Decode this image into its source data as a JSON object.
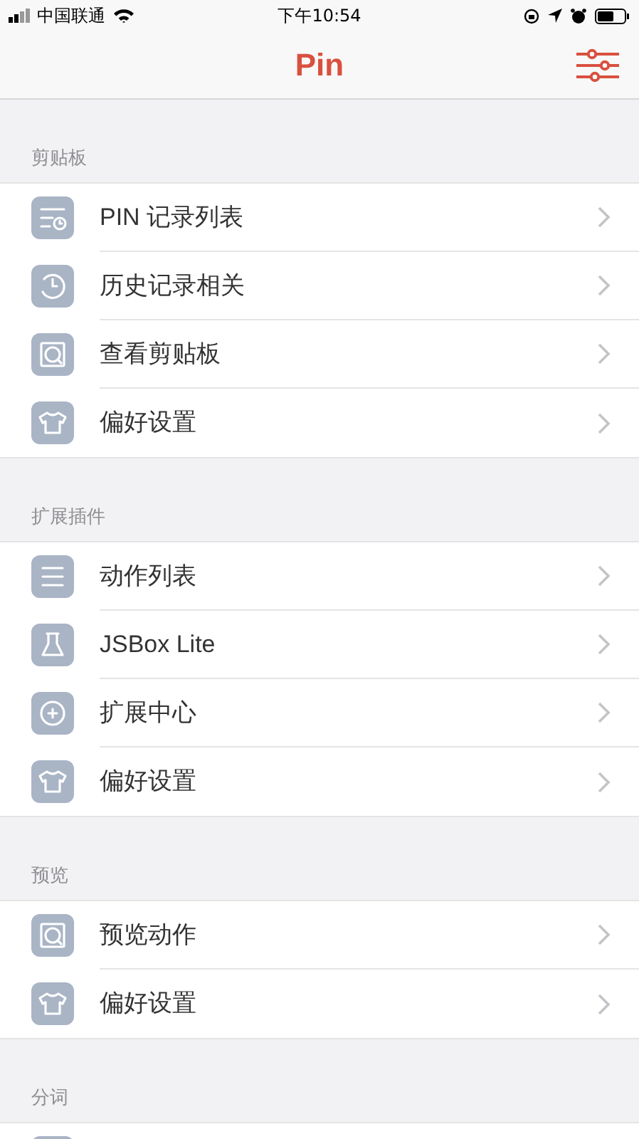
{
  "status_bar": {
    "carrier": "中国联通",
    "time": "下午10:54"
  },
  "nav": {
    "title": "Pin"
  },
  "sections": [
    {
      "title": "剪贴板",
      "rows": [
        {
          "kind": "list-clock",
          "label": "PIN 记录列表"
        },
        {
          "kind": "history",
          "label": "历史记录相关"
        },
        {
          "kind": "clipboard",
          "label": "查看剪贴板"
        },
        {
          "kind": "shirt",
          "label": "偏好设置"
        }
      ]
    },
    {
      "title": "扩展插件",
      "rows": [
        {
          "kind": "list",
          "label": "动作列表"
        },
        {
          "kind": "flask",
          "label": "JSBox Lite"
        },
        {
          "kind": "plus",
          "label": "扩展中心"
        },
        {
          "kind": "shirt",
          "label": "偏好设置"
        }
      ]
    },
    {
      "title": "预览",
      "rows": [
        {
          "kind": "clipboard",
          "label": "预览动作"
        },
        {
          "kind": "shirt",
          "label": "偏好设置"
        }
      ]
    },
    {
      "title": "分词",
      "rows": [
        {
          "kind": "blank"
        }
      ]
    }
  ]
}
